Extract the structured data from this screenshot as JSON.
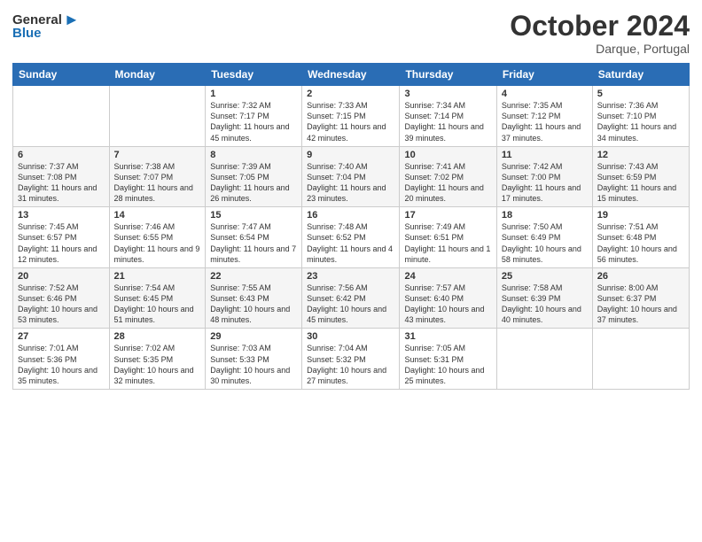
{
  "header": {
    "logo_general": "General",
    "logo_blue": "Blue",
    "month": "October 2024",
    "location": "Darque, Portugal"
  },
  "weekdays": [
    "Sunday",
    "Monday",
    "Tuesday",
    "Wednesday",
    "Thursday",
    "Friday",
    "Saturday"
  ],
  "weeks": [
    [
      {
        "day": "",
        "detail": ""
      },
      {
        "day": "",
        "detail": ""
      },
      {
        "day": "1",
        "detail": "Sunrise: 7:32 AM\nSunset: 7:17 PM\nDaylight: 11 hours and 45 minutes."
      },
      {
        "day": "2",
        "detail": "Sunrise: 7:33 AM\nSunset: 7:15 PM\nDaylight: 11 hours and 42 minutes."
      },
      {
        "day": "3",
        "detail": "Sunrise: 7:34 AM\nSunset: 7:14 PM\nDaylight: 11 hours and 39 minutes."
      },
      {
        "day": "4",
        "detail": "Sunrise: 7:35 AM\nSunset: 7:12 PM\nDaylight: 11 hours and 37 minutes."
      },
      {
        "day": "5",
        "detail": "Sunrise: 7:36 AM\nSunset: 7:10 PM\nDaylight: 11 hours and 34 minutes."
      }
    ],
    [
      {
        "day": "6",
        "detail": "Sunrise: 7:37 AM\nSunset: 7:08 PM\nDaylight: 11 hours and 31 minutes."
      },
      {
        "day": "7",
        "detail": "Sunrise: 7:38 AM\nSunset: 7:07 PM\nDaylight: 11 hours and 28 minutes."
      },
      {
        "day": "8",
        "detail": "Sunrise: 7:39 AM\nSunset: 7:05 PM\nDaylight: 11 hours and 26 minutes."
      },
      {
        "day": "9",
        "detail": "Sunrise: 7:40 AM\nSunset: 7:04 PM\nDaylight: 11 hours and 23 minutes."
      },
      {
        "day": "10",
        "detail": "Sunrise: 7:41 AM\nSunset: 7:02 PM\nDaylight: 11 hours and 20 minutes."
      },
      {
        "day": "11",
        "detail": "Sunrise: 7:42 AM\nSunset: 7:00 PM\nDaylight: 11 hours and 17 minutes."
      },
      {
        "day": "12",
        "detail": "Sunrise: 7:43 AM\nSunset: 6:59 PM\nDaylight: 11 hours and 15 minutes."
      }
    ],
    [
      {
        "day": "13",
        "detail": "Sunrise: 7:45 AM\nSunset: 6:57 PM\nDaylight: 11 hours and 12 minutes."
      },
      {
        "day": "14",
        "detail": "Sunrise: 7:46 AM\nSunset: 6:55 PM\nDaylight: 11 hours and 9 minutes."
      },
      {
        "day": "15",
        "detail": "Sunrise: 7:47 AM\nSunset: 6:54 PM\nDaylight: 11 hours and 7 minutes."
      },
      {
        "day": "16",
        "detail": "Sunrise: 7:48 AM\nSunset: 6:52 PM\nDaylight: 11 hours and 4 minutes."
      },
      {
        "day": "17",
        "detail": "Sunrise: 7:49 AM\nSunset: 6:51 PM\nDaylight: 11 hours and 1 minute."
      },
      {
        "day": "18",
        "detail": "Sunrise: 7:50 AM\nSunset: 6:49 PM\nDaylight: 10 hours and 58 minutes."
      },
      {
        "day": "19",
        "detail": "Sunrise: 7:51 AM\nSunset: 6:48 PM\nDaylight: 10 hours and 56 minutes."
      }
    ],
    [
      {
        "day": "20",
        "detail": "Sunrise: 7:52 AM\nSunset: 6:46 PM\nDaylight: 10 hours and 53 minutes."
      },
      {
        "day": "21",
        "detail": "Sunrise: 7:54 AM\nSunset: 6:45 PM\nDaylight: 10 hours and 51 minutes."
      },
      {
        "day": "22",
        "detail": "Sunrise: 7:55 AM\nSunset: 6:43 PM\nDaylight: 10 hours and 48 minutes."
      },
      {
        "day": "23",
        "detail": "Sunrise: 7:56 AM\nSunset: 6:42 PM\nDaylight: 10 hours and 45 minutes."
      },
      {
        "day": "24",
        "detail": "Sunrise: 7:57 AM\nSunset: 6:40 PM\nDaylight: 10 hours and 43 minutes."
      },
      {
        "day": "25",
        "detail": "Sunrise: 7:58 AM\nSunset: 6:39 PM\nDaylight: 10 hours and 40 minutes."
      },
      {
        "day": "26",
        "detail": "Sunrise: 8:00 AM\nSunset: 6:37 PM\nDaylight: 10 hours and 37 minutes."
      }
    ],
    [
      {
        "day": "27",
        "detail": "Sunrise: 7:01 AM\nSunset: 5:36 PM\nDaylight: 10 hours and 35 minutes."
      },
      {
        "day": "28",
        "detail": "Sunrise: 7:02 AM\nSunset: 5:35 PM\nDaylight: 10 hours and 32 minutes."
      },
      {
        "day": "29",
        "detail": "Sunrise: 7:03 AM\nSunset: 5:33 PM\nDaylight: 10 hours and 30 minutes."
      },
      {
        "day": "30",
        "detail": "Sunrise: 7:04 AM\nSunset: 5:32 PM\nDaylight: 10 hours and 27 minutes."
      },
      {
        "day": "31",
        "detail": "Sunrise: 7:05 AM\nSunset: 5:31 PM\nDaylight: 10 hours and 25 minutes."
      },
      {
        "day": "",
        "detail": ""
      },
      {
        "day": "",
        "detail": ""
      }
    ]
  ]
}
